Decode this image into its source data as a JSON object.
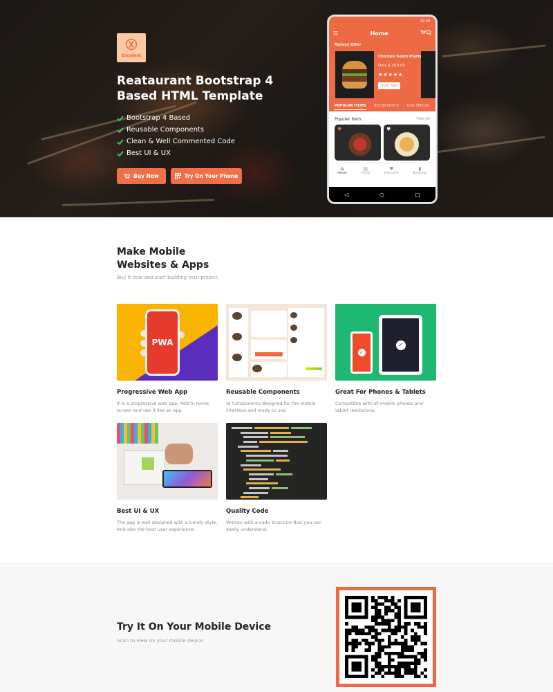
{
  "brand": {
    "logo_text": "Esculent"
  },
  "hero": {
    "title": "Reataurant Bootstrap 4 Based HTML Template",
    "features": [
      "Bootstrap 4 Based",
      "Reusable Components",
      "Clean & Well Commented Code",
      "Best UI & UX"
    ],
    "buy_label": "Buy Now",
    "try_label": "Try On Your Phone"
  },
  "phone": {
    "status_time": "12:30",
    "header_title": "Home",
    "offer_label": "Todays Offer",
    "offer_name": "Chicken Sushi Platter.",
    "offer_price": "Only $ 350.00",
    "stars": "★★★★★",
    "order_label": "Order Now",
    "tabs": [
      "POPULAR ITEMS",
      "RECOMENDED",
      "OUR SPECIAL"
    ],
    "popular_label": "Populer Item",
    "view_all": "View All",
    "nav": [
      "Home",
      "Foods",
      "Favourite",
      "Bookings"
    ]
  },
  "features_section": {
    "title_line1": "Make Mobile",
    "title_line2": "Websites & Apps",
    "subtitle": "Buy it now and start building your project.",
    "pwa_badge": "PWA",
    "cards": [
      {
        "title": "Progressive Web App",
        "desc": "It is a progressive web app. Add to home screen and use it like an app."
      },
      {
        "title": "Reusable Components",
        "desc": "UI Components designed for the mobile interface and ready to use."
      },
      {
        "title": "Great For Phones & Tablets",
        "desc": "Compatible with all mobile phones and tablet resolutions."
      },
      {
        "title": "Best UI & UX",
        "desc": "The app is well designed with a trendy style. And also the best user experience."
      },
      {
        "title": "Quality Code",
        "desc": "Written with a code structure that you can easily understand."
      }
    ]
  },
  "qr_section": {
    "title": "Try It On Your Mobile Device",
    "subtitle": "Scan to view on your mobile device"
  },
  "colors": {
    "accent": "#ee6a44",
    "pwa_bg": "#f8b400",
    "tablet_bg": "#1fb872",
    "code_bg": "#252523"
  }
}
